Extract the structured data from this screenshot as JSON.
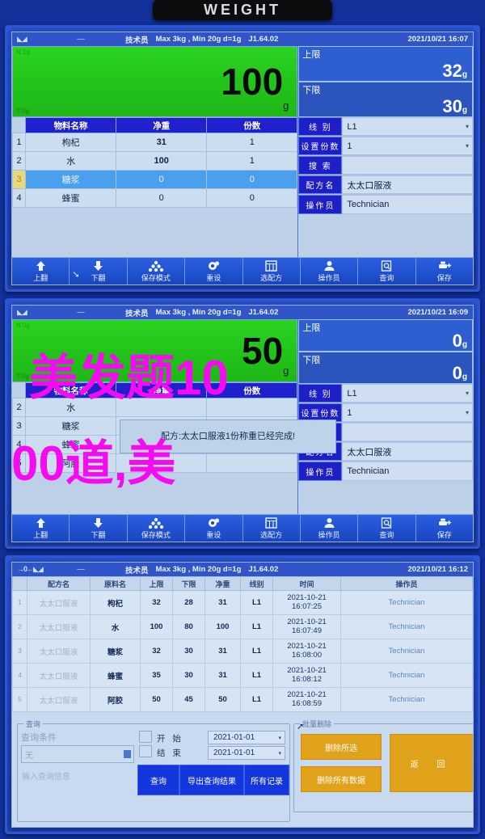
{
  "device": {
    "badge_label": "WEIGHT"
  },
  "panel1": {
    "status": {
      "operator_role": "技术员",
      "capacity": "Max 3kg , Min 20g  d=1g",
      "firmware": "J1.64.02",
      "datetime": "2021/10/21  16:07",
      "net_label": "N:1g"
    },
    "display": {
      "value": "100",
      "unit": "g",
      "tare": "T:0g"
    },
    "table": {
      "headers": [
        "物料名称",
        "净重",
        "份数"
      ],
      "rows": [
        {
          "idx": "1",
          "name": "枸杞",
          "net": "31",
          "portion": "1",
          "state": "done"
        },
        {
          "idx": "2",
          "name": "水",
          "net": "100",
          "portion": "1",
          "state": "done"
        },
        {
          "idx": "3",
          "name": "糖浆",
          "net": "0",
          "portion": "0",
          "state": "selected"
        },
        {
          "idx": "4",
          "name": "蜂蜜",
          "net": "0",
          "portion": "0",
          "state": "idle"
        }
      ]
    },
    "limits": {
      "upper_label": "上限",
      "upper_value": "32",
      "upper_unit": "g",
      "lower_label": "下限",
      "lower_value": "30",
      "lower_unit": "g"
    },
    "fields": [
      {
        "label": "线  别",
        "value": "L1",
        "caret": "▾"
      },
      {
        "label": "设置份数",
        "value": "1",
        "caret": "▾"
      },
      {
        "label": "搜  索",
        "value": "",
        "caret": ""
      },
      {
        "label": "配方名",
        "value": "太太口服液",
        "caret": ""
      },
      {
        "label": "操作员",
        "value": "Technician",
        "caret": ""
      }
    ]
  },
  "panel2": {
    "status": {
      "operator_role": "技术员",
      "capacity": "Max 3kg , Min 20g  d=1g",
      "firmware": "J1.64.02",
      "datetime": "2021/10/21  16:09",
      "net_label": "N:0g"
    },
    "display": {
      "value": "50",
      "unit": "g",
      "tare": "T:0g"
    },
    "table": {
      "headers": [
        "物料名称",
        "净重",
        "份数"
      ],
      "rows": [
        {
          "idx": "2",
          "name": "水",
          "net": "",
          "portion": "",
          "state": "idle"
        },
        {
          "idx": "3",
          "name": "糖浆",
          "net": "",
          "portion": "",
          "state": "idle"
        },
        {
          "idx": "4",
          "name": "蜂蜜",
          "net": "",
          "portion": "",
          "state": "idle"
        },
        {
          "idx": "5",
          "name": "阿胶",
          "net": "",
          "portion": "",
          "state": "idle"
        }
      ]
    },
    "limits": {
      "upper_label": "上限",
      "upper_value": "0",
      "upper_unit": "g",
      "lower_label": "下限",
      "lower_value": "0",
      "lower_unit": "g"
    },
    "fields": [
      {
        "label": "线  别",
        "value": "L1",
        "caret": "▾"
      },
      {
        "label": "设置份数",
        "value": "1",
        "caret": "▾"
      },
      {
        "label": "搜  索",
        "value": "",
        "caret": ""
      },
      {
        "label": "配方名",
        "value": "太太口服液",
        "caret": ""
      },
      {
        "label": "操作员",
        "value": "Technician",
        "caret": ""
      }
    ],
    "dialog": {
      "message": "配方:太太口服液1份称重已经完成!"
    }
  },
  "toolbar": {
    "buttons": [
      {
        "label": "上翻",
        "icon": "arrow-up-icon"
      },
      {
        "label": "下翻",
        "icon": "arrow-down-icon"
      },
      {
        "label": "保存模式",
        "icon": "stack-icon"
      },
      {
        "label": "重设",
        "icon": "gear-icon"
      },
      {
        "label": "选配方",
        "icon": "grid-icon"
      },
      {
        "label": "操作员",
        "icon": "user-icon"
      },
      {
        "label": "查询",
        "icon": "document-search-icon"
      },
      {
        "label": "保存",
        "icon": "printer-plus-icon"
      }
    ]
  },
  "panel3": {
    "status": {
      "operator_role": "技术员",
      "capacity": "Max 3kg , Min 20g  d=1g",
      "firmware": "J1.64.02",
      "datetime": "2021/10/21  16:12",
      "zero_label": "→0←"
    },
    "table": {
      "headers": [
        "配方名",
        "原料名",
        "上限",
        "下限",
        "净重",
        "线别",
        "时间",
        "操作员"
      ],
      "rows": [
        {
          "idx": "1",
          "recipe": "太太口服液",
          "material": "枸杞",
          "upper": "32",
          "lower": "28",
          "net": "31",
          "line": "L1",
          "date": "2021-10-21",
          "time": "16:07:25",
          "operator": "Technician"
        },
        {
          "idx": "2",
          "recipe": "太太口服液",
          "material": "水",
          "upper": "100",
          "lower": "80",
          "net": "100",
          "line": "L1",
          "date": "2021-10-21",
          "time": "16:07:49",
          "operator": "Technician"
        },
        {
          "idx": "3",
          "recipe": "太太口服液",
          "material": "糖浆",
          "upper": "32",
          "lower": "30",
          "net": "31",
          "line": "L1",
          "date": "2021-10-21",
          "time": "16:08:00",
          "operator": "Technician"
        },
        {
          "idx": "4",
          "recipe": "太太口服液",
          "material": "蜂蜜",
          "upper": "35",
          "lower": "30",
          "net": "31",
          "line": "L1",
          "date": "2021-10-21",
          "time": "16:08:12",
          "operator": "Technician"
        },
        {
          "idx": "5",
          "recipe": "太太口服液",
          "material": "阿胶",
          "upper": "50",
          "lower": "45",
          "net": "50",
          "line": "L1",
          "date": "2021-10-21",
          "time": "16:08:59",
          "operator": "Technician"
        }
      ]
    },
    "query": {
      "group_label": "查询",
      "condition_label": "查询条件",
      "condition_value": "无",
      "info_placeholder": "输入查询信息",
      "start_label": "开  始",
      "start_value": "2021-01-01",
      "end_label": "结  束",
      "end_value": "2021-01-01",
      "btn_query": "查询",
      "btn_export": "导出查询结果",
      "btn_all": "所有记录"
    },
    "batch": {
      "group_label": "批量删除",
      "btn_delete_selected": "删除所选",
      "btn_delete_all": "删除所有数据",
      "btn_return": "返 回"
    }
  },
  "watermark": {
    "line1": "美发题10",
    "line2": "00道,美"
  },
  "colors": {
    "accent_blue": "#1436dd",
    "display_green": "#22c41a",
    "header_blue": "#2020cc",
    "orange": "#dfa21a",
    "watermark_magenta": "#f40bf0"
  }
}
